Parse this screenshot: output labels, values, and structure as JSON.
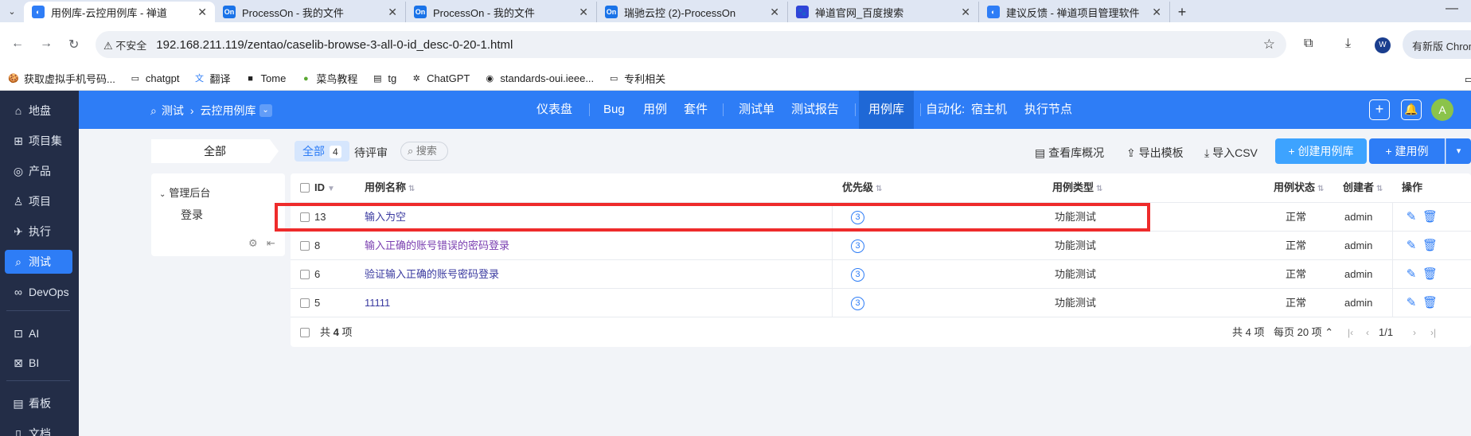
{
  "browser": {
    "tabs": [
      {
        "title": "用例库-云控用例库 - 禅道",
        "active": true,
        "favicon_color": "#2e7df6",
        "favicon_text": "◐"
      },
      {
        "title": "ProcessOn - 我的文件",
        "active": false,
        "favicon_color": "#1a73e8",
        "favicon_text": "On"
      },
      {
        "title": "ProcessOn - 我的文件",
        "active": false,
        "favicon_color": "#1a73e8",
        "favicon_text": "On"
      },
      {
        "title": "瑞驰云控 (2)-ProcessOn",
        "active": false,
        "favicon_color": "#1a73e8",
        "favicon_text": "On"
      },
      {
        "title": "禅道官网_百度搜索",
        "active": false,
        "favicon_color": "#3045d8",
        "favicon_text": "🐾"
      },
      {
        "title": "建议反馈 - 禅道项目管理软件",
        "active": false,
        "favicon_color": "#2e7df6",
        "favicon_text": "◐"
      }
    ],
    "security_label": "不安全",
    "url": "192.168.211.119/zentao/caselib-browse-3-all-0-id_desc-0-20-1.html",
    "profile_initial": "W",
    "update_label": "有新版 Chrome",
    "bookmarks": [
      {
        "label": "获取虚拟手机号码...",
        "icon": "🍪"
      },
      {
        "label": "chatgpt",
        "icon": "▭"
      },
      {
        "label": "翻译",
        "icon": "文"
      },
      {
        "label": "Tome",
        "icon": "■"
      },
      {
        "label": "菜鸟教程",
        "icon": "●"
      },
      {
        "label": "tg",
        "icon": "▤"
      },
      {
        "label": "ChatGPT",
        "icon": "✲"
      },
      {
        "label": "standards-oui.ieee...",
        "icon": "◉"
      },
      {
        "label": "专利相关",
        "icon": "▭"
      }
    ]
  },
  "sidebar": {
    "items": [
      {
        "label": "地盘",
        "icon": "⌂",
        "name": "home"
      },
      {
        "label": "项目集",
        "icon": "⊞",
        "name": "program"
      },
      {
        "label": "产品",
        "icon": "◎",
        "name": "product"
      },
      {
        "label": "项目",
        "icon": "♙",
        "name": "project"
      },
      {
        "label": "执行",
        "icon": "✈",
        "name": "execution"
      },
      {
        "label": "测试",
        "icon": "⌕",
        "name": "test"
      },
      {
        "label": "DevOps",
        "icon": "∞",
        "name": "devops"
      },
      {
        "label": "AI",
        "icon": "⊡",
        "name": "ai"
      },
      {
        "label": "BI",
        "icon": "⊠",
        "name": "bi"
      },
      {
        "label": "看板",
        "icon": "▤",
        "name": "kanban"
      },
      {
        "label": "文档",
        "icon": "▯",
        "name": "doc"
      }
    ],
    "active": "测试"
  },
  "header": {
    "crumb_root": "测试",
    "crumb_current": "云控用例库",
    "nav": [
      "仪表盘",
      "Bug",
      "用例",
      "套件",
      "测试单",
      "测试报告",
      "用例库",
      "自动化:",
      "宿主机",
      "执行节点"
    ],
    "active_nav": "用例库",
    "avatar": "A"
  },
  "toolbar": {
    "all_module": "全部",
    "filter_all": "全部",
    "filter_all_count": "4",
    "filter_pending": "待评审",
    "search": "搜索",
    "view_overview": "查看库概况",
    "export_template": "导出模板",
    "import_csv": "导入CSV",
    "create_lib": "创建用例库",
    "create_case": "建用例"
  },
  "tree": {
    "root": "管理后台",
    "child": "登录"
  },
  "table": {
    "headers": {
      "id": "ID",
      "name": "用例名称",
      "priority": "优先级",
      "type": "用例类型",
      "status": "用例状态",
      "creator": "创建者",
      "actions": "操作"
    },
    "rows": [
      {
        "id": "13",
        "name": "输入为空",
        "priority": "3",
        "type": "功能测试",
        "status": "正常",
        "creator": "admin"
      },
      {
        "id": "8",
        "name": "输入正确的账号错误的密码登录",
        "priority": "3",
        "type": "功能测试",
        "status": "正常",
        "creator": "admin"
      },
      {
        "id": "6",
        "name": "验证输入正确的账号密码登录",
        "priority": "3",
        "type": "功能测试",
        "status": "正常",
        "creator": "admin"
      },
      {
        "id": "5",
        "name": "11111",
        "priority": "3",
        "type": "功能测试",
        "status": "正常",
        "creator": "admin"
      }
    ],
    "footer": {
      "summary_prefix": "共",
      "summary_count": "4",
      "summary_suffix": "项",
      "total": "共 4 项",
      "per_page": "每页 20 项",
      "page": "1/1"
    }
  },
  "colors": {
    "accent": "#2e7df6",
    "sidebar_bg": "#232d47",
    "highlight": "#ee2b2b"
  }
}
